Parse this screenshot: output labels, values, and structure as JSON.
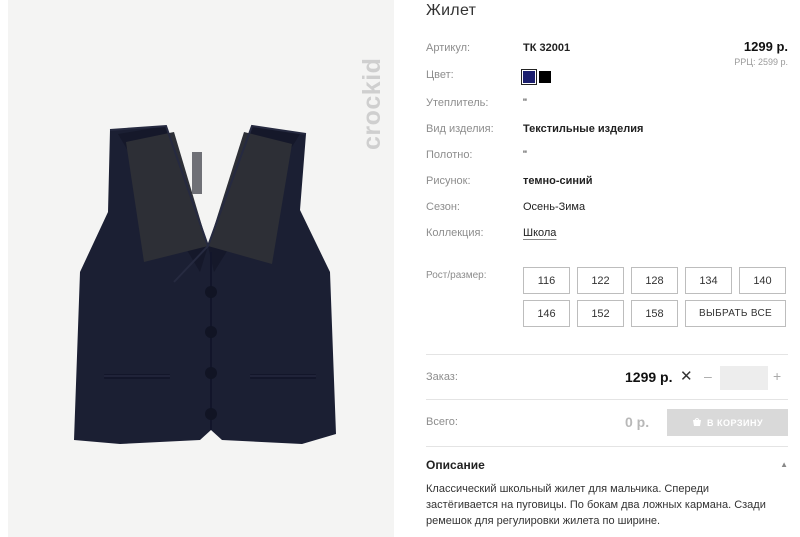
{
  "product": {
    "title": "Жилет",
    "price": "1299 р.",
    "rrp": "РРЦ: 2599 р."
  },
  "brand": {
    "logo_text": "crockid"
  },
  "specs": {
    "article": {
      "label": "Артикул:",
      "value": "ТК 32001"
    },
    "color": {
      "label": "Цвет:",
      "swatches": [
        "#1c1f6e",
        "#000000"
      ]
    },
    "insulation": {
      "label": "Утеплитель:",
      "value": "\""
    },
    "type": {
      "label": "Вид изделия:",
      "value": "Текстильные изделия"
    },
    "fabric": {
      "label": "Полотно:",
      "value": "\""
    },
    "pattern": {
      "label": "Рисунок:",
      "value": "темно-синий"
    },
    "season": {
      "label": "Сезон:",
      "value": "Осень-Зима"
    },
    "collection": {
      "label": "Коллекция:",
      "value": "Школа"
    }
  },
  "sizes": {
    "label": "Рост/размер:",
    "options": [
      "116",
      "122",
      "128",
      "134",
      "140",
      "146",
      "152",
      "158"
    ],
    "select_all": "ВЫБРАТЬ ВСЕ"
  },
  "order": {
    "label": "Заказ:",
    "price": "1299 р.",
    "times": "✕",
    "minus": "–",
    "plus": "+",
    "quantity": ""
  },
  "total": {
    "label": "Всего:",
    "value": "0 р.",
    "cart_button": "В КОРЗИНУ"
  },
  "description": {
    "title": "Описание",
    "chevron": "▲",
    "text": "Классический школьный жилет для мальчика. Спереди застёгивается на пуговицы. По бокам два ложных кармана. Сзади ремешок для регулировки жилета по ширине."
  },
  "colors": {
    "vest": "#1b1f33",
    "accent_swatch": "#1c1f6e",
    "cart_button": "#d9d9d9",
    "gallery_bg": "#f4f4f3"
  }
}
